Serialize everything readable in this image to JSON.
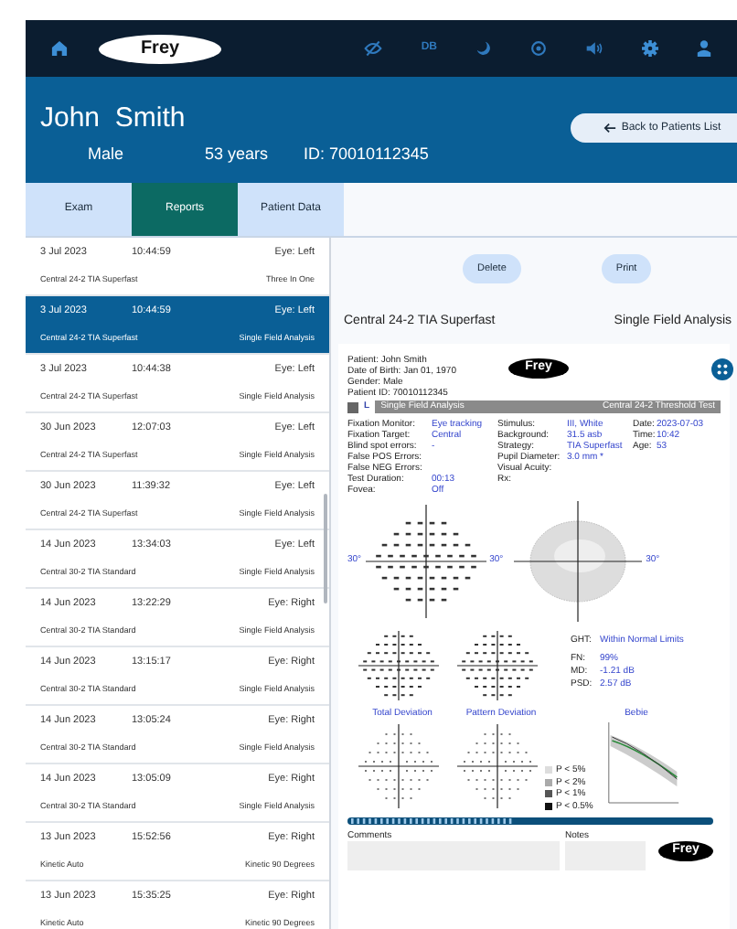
{
  "topbar": {
    "logo": "Frey",
    "db_label": "DB"
  },
  "patient": {
    "name": "John  Smith",
    "gender": "Male",
    "age": "53 years",
    "id": "ID: 70010112345",
    "back_button": "Back to Patients List"
  },
  "tabs": [
    {
      "label": "Exam",
      "selected": false
    },
    {
      "label": "Reports",
      "selected": true
    },
    {
      "label": "Patient Data",
      "selected": false
    }
  ],
  "exams": [
    {
      "date": "3 Jul 2023",
      "time": "10:44:59",
      "eye": "Eye: Left",
      "test": "Central 24-2 TIA Superfast",
      "analysis": "Three In One",
      "selected": false
    },
    {
      "date": "3 Jul 2023",
      "time": "10:44:59",
      "eye": "Eye: Left",
      "test": "Central 24-2 TIA Superfast",
      "analysis": "Single Field Analysis",
      "selected": true
    },
    {
      "date": "3 Jul 2023",
      "time": "10:44:38",
      "eye": "Eye: Left",
      "test": "Central 24-2 TIA Superfast",
      "analysis": "Single Field Analysis",
      "selected": false
    },
    {
      "date": "30 Jun 2023",
      "time": "12:07:03",
      "eye": "Eye: Left",
      "test": "Central 24-2 TIA Superfast",
      "analysis": "Single Field Analysis",
      "selected": false
    },
    {
      "date": "30 Jun 2023",
      "time": "11:39:32",
      "eye": "Eye: Left",
      "test": "Central 24-2 TIA Superfast",
      "analysis": "Single Field Analysis",
      "selected": false
    },
    {
      "date": "14 Jun 2023",
      "time": "13:34:03",
      "eye": "Eye: Left",
      "test": "Central 30-2 TIA Standard",
      "analysis": "Single Field Analysis",
      "selected": false
    },
    {
      "date": "14 Jun 2023",
      "time": "13:22:29",
      "eye": "Eye: Right",
      "test": "Central 30-2 TIA Standard",
      "analysis": "Single Field Analysis",
      "selected": false
    },
    {
      "date": "14 Jun 2023",
      "time": "13:15:17",
      "eye": "Eye: Right",
      "test": "Central 30-2 TIA Standard",
      "analysis": "Single Field Analysis",
      "selected": false
    },
    {
      "date": "14 Jun 2023",
      "time": "13:05:24",
      "eye": "Eye: Right",
      "test": "Central 30-2 TIA Standard",
      "analysis": "Single Field Analysis",
      "selected": false
    },
    {
      "date": "14 Jun 2023",
      "time": "13:05:09",
      "eye": "Eye: Right",
      "test": "Central 30-2 TIA Standard",
      "analysis": "Single Field Analysis",
      "selected": false
    },
    {
      "date": "13 Jun 2023",
      "time": "15:52:56",
      "eye": "Eye: Right",
      "test": "Kinetic Auto",
      "analysis": "Kinetic 90 Degrees",
      "selected": false
    },
    {
      "date": "13 Jun 2023",
      "time": "15:35:25",
      "eye": "Eye: Right",
      "test": "Kinetic Auto",
      "analysis": "Kinetic 90 Degrees",
      "selected": false
    }
  ],
  "actions": [
    "Delete",
    "Print"
  ],
  "report_title": {
    "test": "Central 24-2 TIA Superfast",
    "analysis": "Single Field Analysis"
  },
  "report": {
    "patient_lines": [
      "Patient: John Smith",
      "Date of Birth: Jan 01, 1970",
      "Gender: Male",
      "Patient ID: 70010112345"
    ],
    "logo": "Frey",
    "eye": "L",
    "section": "Single Field Analysis",
    "test_name": "Central 24-2 Threshold Test",
    "params": [
      [
        {
          "label": "Fixation Monitor:",
          "value": "Eye tracking"
        },
        {
          "label": "Fixation Target:",
          "value": "Central"
        },
        {
          "label": "Blind spot errors:",
          "value": "-"
        },
        {
          "label": "False POS Errors:"
        },
        {
          "label": "False NEG Errors:"
        },
        {
          "label": "Test Duration:",
          "value": "00:13"
        },
        {
          "label": "Fovea:",
          "value": "Off"
        }
      ],
      [
        {
          "label": "Stimulus:",
          "value": "III, White"
        },
        {
          "label": "Background:",
          "value": "31.5 asb"
        },
        {
          "label": "Strategy:",
          "value": "TIA Superfast"
        },
        {
          "label": "Pupil Diameter:",
          "value": "3.0 mm *"
        },
        {
          "label": "Visual Acuity:"
        },
        {
          "label": "Rx:"
        }
      ],
      [
        {
          "label": "Date:",
          "value": "2023-07-03"
        },
        {
          "label": "Time:",
          "value": "10:42"
        },
        {
          "label": "Age:",
          "value": "53"
        }
      ]
    ],
    "axis_labels": [
      "30°",
      "30°",
      "30°"
    ],
    "indices": [
      {
        "label": "GHT:",
        "value": "Within Normal Limits"
      },
      {
        "label": "FN:",
        "value": "99%"
      },
      {
        "label": "MD:",
        "value": "-1.21 dB"
      },
      {
        "label": "PSD:",
        "value": "2.57 dB"
      }
    ],
    "plot_titles": [
      "Total Deviation",
      "Pattern Deviation",
      "Bebie"
    ],
    "legend": [
      "P < 5%",
      "P < 2%",
      "P < 1%",
      "P < 0.5%"
    ],
    "boxes": [
      "Comments",
      "Notes"
    ],
    "footer_logo": "Frey"
  }
}
